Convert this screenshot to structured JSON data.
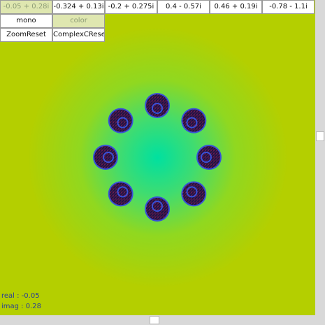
{
  "presets": [
    {
      "label": "-0.05 + 0.28i",
      "active": true
    },
    {
      "label": "-0.324 + 0.13i",
      "active": false
    },
    {
      "label": "-0.2 + 0.275i",
      "active": false
    },
    {
      "label": "0.4 - 0.57i",
      "active": false
    },
    {
      "label": "0.46 + 0.19i",
      "active": false
    },
    {
      "label": "-0.78 - 1.1i",
      "active": false
    }
  ],
  "color_modes": [
    {
      "label": "mono",
      "active": false
    },
    {
      "label": "color",
      "active": true
    }
  ],
  "actions": {
    "zoom_reset": "ZoomReset",
    "complex_reset": "ComplexCReset"
  },
  "readout": {
    "real": "real : -0.05",
    "imag": "imag : 0.28"
  },
  "scroll": {
    "vertical_position": 0.43,
    "horizontal_position": 0.49
  },
  "colors": {
    "background": "#b4cf00",
    "glow": "#00e0a0",
    "set": "#1a1446",
    "set_speckle": "#c02050",
    "set_ring": "#3850d8",
    "readout_text": "#2a3f93"
  }
}
